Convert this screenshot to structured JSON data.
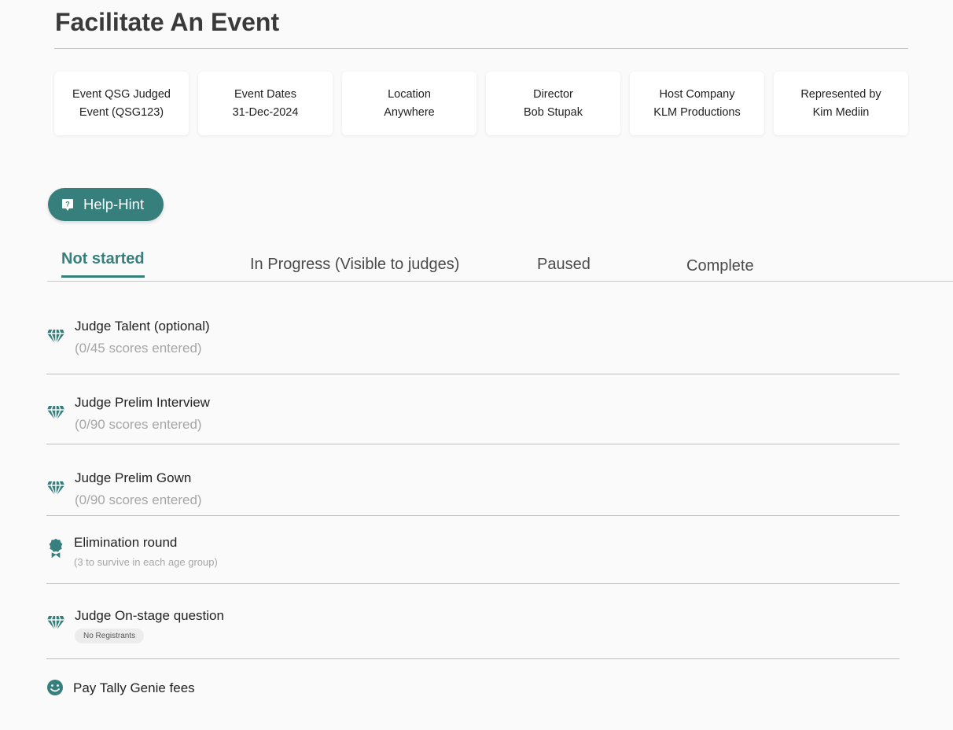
{
  "page": {
    "title": "Facilitate An Event"
  },
  "cards": [
    {
      "label": "Event QSG Judged",
      "value": "Event (QSG123)"
    },
    {
      "label": "Event Dates",
      "value": "31-Dec-2024"
    },
    {
      "label": "Location",
      "value": "Anywhere"
    },
    {
      "label": "Director",
      "value": "Bob Stupak"
    },
    {
      "label": "Host Company",
      "value": "KLM Productions"
    },
    {
      "label": "Represented by",
      "value": "Kim Mediin"
    }
  ],
  "help": {
    "label": "Help-Hint",
    "icon": "help-icon"
  },
  "tabs": [
    {
      "label": "Not started",
      "active": true
    },
    {
      "label": "In Progress (Visible to judges)",
      "active": false
    },
    {
      "label": "Paused",
      "active": false
    },
    {
      "label": "Complete",
      "active": false
    }
  ],
  "steps": [
    {
      "title": "Judge Talent (optional)",
      "subtitle": "(0/45 scores entered)",
      "icon": "judging-icon"
    },
    {
      "title": "Judge Prelim Interview",
      "subtitle": "(0/90 scores entered)",
      "icon": "judging-icon"
    },
    {
      "title": "Judge Prelim Gown",
      "subtitle": "(0/90 scores entered)",
      "icon": "judging-icon"
    },
    {
      "title": "Elimination round",
      "subtitle": "(3 to survive in each age group)",
      "icon": "award-ribbon-icon"
    },
    {
      "title": "Judge On-stage question",
      "badge": "No Registrants",
      "icon": "judging-icon"
    },
    {
      "title": "Pay Tally Genie fees",
      "icon": "smiley-icon"
    }
  ],
  "colors": {
    "accent": "#367f7d",
    "muted": "#a6a6a6",
    "background": "#fafafa"
  }
}
